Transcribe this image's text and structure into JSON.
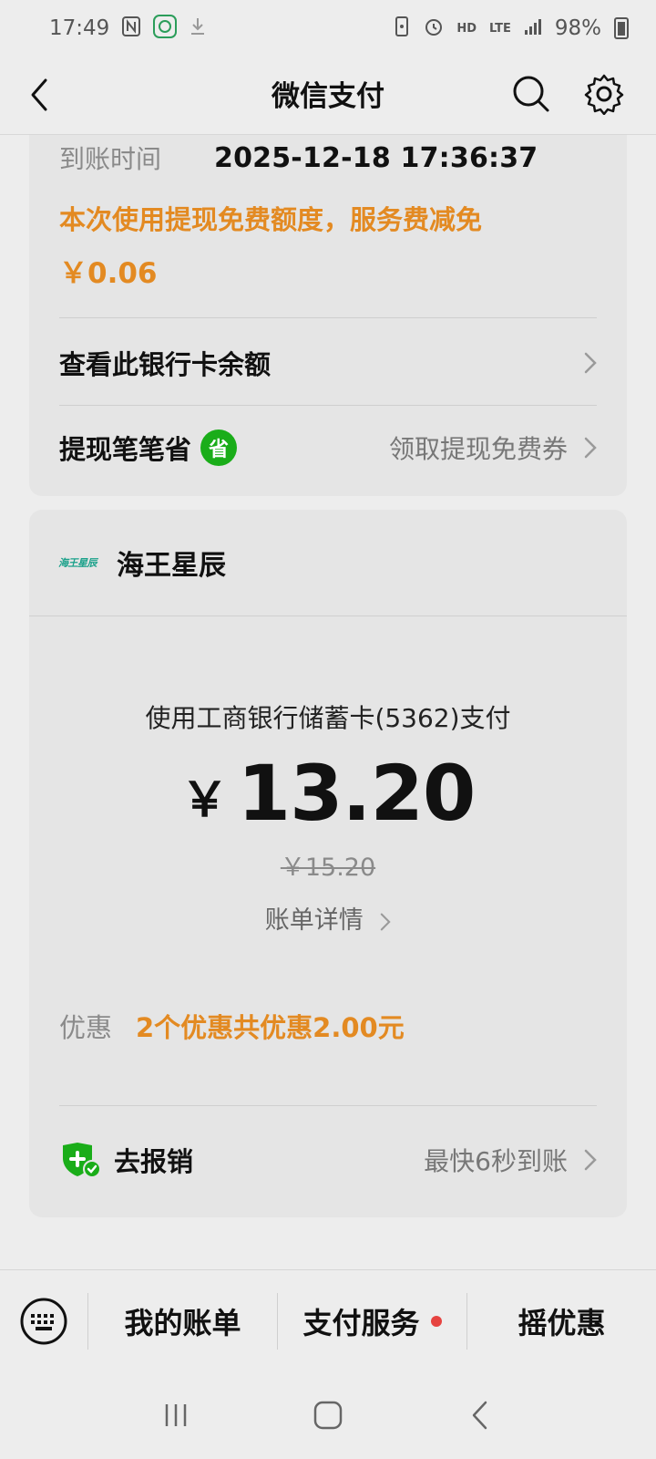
{
  "status_bar": {
    "time": "17:49",
    "battery": "98%",
    "icons": [
      "nfc-icon",
      "app-notification-icon",
      "download-icon",
      "vibrate-icon",
      "alarm-icon",
      "hd-icon",
      "lte-icon",
      "signal-icon",
      "battery-icon"
    ],
    "hd_label": "HD",
    "lte_label": "LTE"
  },
  "header": {
    "title": "微信支付"
  },
  "arrival": {
    "time_label": "到账时间",
    "time_value": "2025-12-18 17:36:37",
    "free_note": "本次使用提现免费额度，服务费减免",
    "free_amount": "￥0.06"
  },
  "rows": {
    "check_balance": "查看此银行卡余额",
    "withdraw_save": "提现笔笔省",
    "save_badge": "省",
    "withdraw_coupon": "领取提现免费券"
  },
  "merchant": {
    "logo_text": "海王星辰",
    "name": "海王星辰"
  },
  "payment": {
    "method": "使用工商银行储蓄卡(5362)支付",
    "currency": "￥",
    "amount": "13.20",
    "original_amount": "￥15.20",
    "bill_detail": "账单详情"
  },
  "discount": {
    "label": "优惠",
    "value": "2个优惠共优惠2.00元"
  },
  "reimburse": {
    "label": "去报销",
    "right": "最快6秒到账"
  },
  "bottom_bar": {
    "tabs": [
      "我的账单",
      "支付服务",
      "摇优惠"
    ]
  },
  "colors": {
    "accent_orange": "#e38a22",
    "wechat_green": "#1aad19",
    "background": "#ededed",
    "card": "#e5e5e5"
  }
}
